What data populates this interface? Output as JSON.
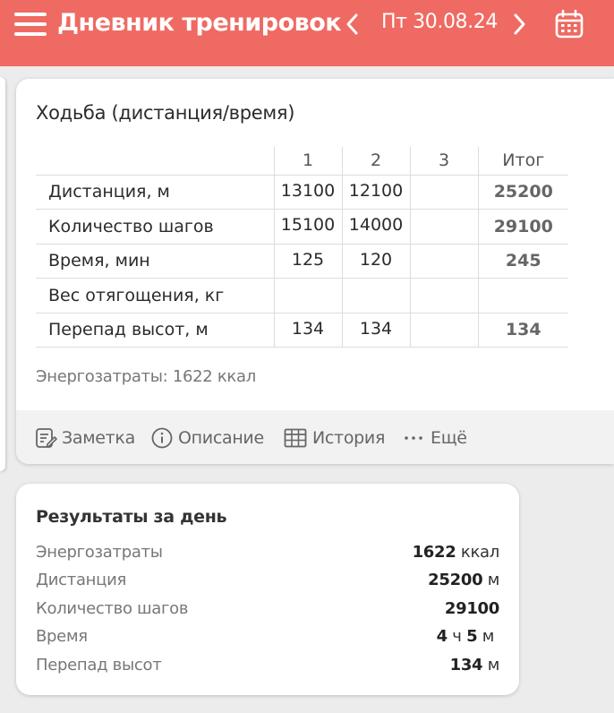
{
  "header": {
    "title": "Дневник тренировок",
    "date": "Пт 30.08.24",
    "bg_color": "#ee6a62"
  },
  "exercise": {
    "title": "Ходьба (дистанция/время)",
    "columns": [
      "1",
      "2",
      "3",
      "Итог"
    ],
    "rows": [
      {
        "label": "Дистанция, м",
        "cells": [
          "13100",
          "12100",
          "",
          "25200"
        ]
      },
      {
        "label": "Количество шагов",
        "cells": [
          "15100",
          "14000",
          "",
          "29100"
        ]
      },
      {
        "label": "Время, мин",
        "cells": [
          "125",
          "120",
          "",
          "245"
        ]
      },
      {
        "label": "Вес отягощения, кг",
        "cells": [
          "",
          "",
          "",
          ""
        ]
      },
      {
        "label": "Перепад высот, м",
        "cells": [
          "134",
          "134",
          "",
          "134"
        ]
      }
    ],
    "energy": "Энергозатраты: 1622 ккал",
    "actions": {
      "note": "Заметка",
      "description": "Описание",
      "history": "История",
      "more": "Ещё"
    }
  },
  "summary": {
    "title": "Результаты за день",
    "rows": [
      {
        "label": "Энергозатраты",
        "value": "1622",
        "unit": "ккал"
      },
      {
        "label": "Дистанция",
        "value": "25200",
        "unit": "м"
      },
      {
        "label": "Количество шагов",
        "value": "29100",
        "unit": ""
      },
      {
        "label": "Время",
        "value_h": "4",
        "unit_h": "ч",
        "value_m": "5",
        "unit_m": "м"
      },
      {
        "label": "Перепад высот",
        "value": "134",
        "unit": "м"
      }
    ]
  }
}
